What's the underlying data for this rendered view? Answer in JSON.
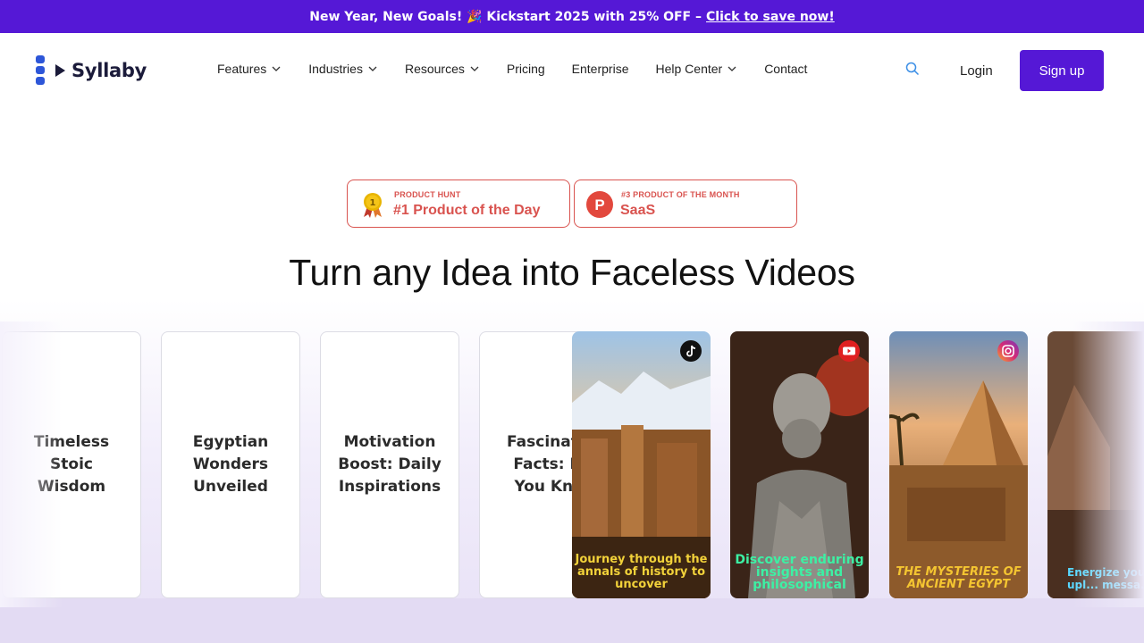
{
  "promo": {
    "text": "New Year, New Goals! 🎉 Kickstart 2025 with 25% OFF –",
    "link": "Click to save now!"
  },
  "brand": {
    "name": "Syllaby"
  },
  "nav": {
    "items": [
      {
        "label": "Features",
        "dropdown": true
      },
      {
        "label": "Industries",
        "dropdown": true
      },
      {
        "label": "Resources",
        "dropdown": true
      },
      {
        "label": "Pricing",
        "dropdown": false
      },
      {
        "label": "Enterprise",
        "dropdown": false
      },
      {
        "label": "Help Center",
        "dropdown": true
      },
      {
        "label": "Contact",
        "dropdown": false
      }
    ],
    "login": "Login",
    "signup": "Sign up"
  },
  "badges": [
    {
      "small": "PRODUCT HUNT",
      "big": "#1 Product of the Day",
      "icon": "medal-icon"
    },
    {
      "small": "#3 PRODUCT OF THE MONTH",
      "big": "SaaS",
      "icon": "product-hunt-icon"
    }
  ],
  "hero": {
    "headline": "Turn any Idea into Faceless Videos"
  },
  "idea_cards": [
    "Timeless Stoic Wisdom",
    "Egyptian Wonders Unveiled",
    "Motivation Boost: Daily Inspirations",
    "Fascinating Facts: Did You Know"
  ],
  "video_thumbs": [
    {
      "caption": "Journey through the annals of history to uncover",
      "platform": "tiktok-icon"
    },
    {
      "caption": "Discover enduring insights and philosophical",
      "platform": "youtube-icon"
    },
    {
      "caption": "THE MYSTERIES OF ANCIENT EGYPT",
      "platform": "instagram-icon"
    },
    {
      "caption": "Energize your with upl... messa...",
      "platform": ""
    }
  ],
  "colors": {
    "brand": "#5518d6",
    "badge": "#d9534f"
  }
}
